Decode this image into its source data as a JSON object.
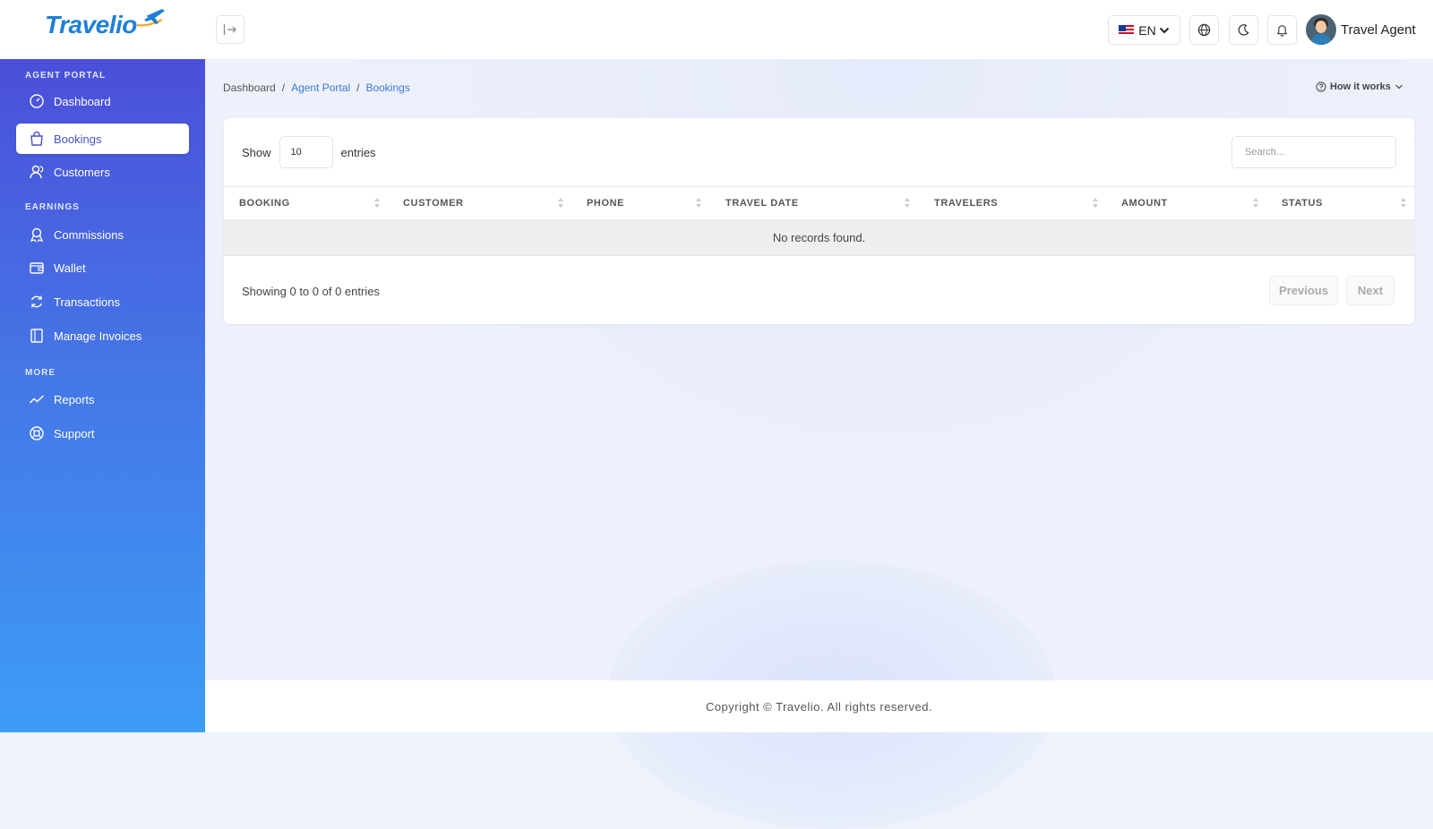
{
  "header": {
    "logo_text": "Travelio",
    "language": "EN",
    "user_name": "Travel Agent"
  },
  "sidebar": {
    "sections": [
      {
        "title": "AGENT PORTAL"
      },
      {
        "title": "EARNINGS"
      },
      {
        "title": "MORE"
      }
    ],
    "items": [
      {
        "label": "Dashboard",
        "icon": "speedometer-icon"
      },
      {
        "label": "Bookings",
        "icon": "shopping-bag-icon",
        "active": true
      },
      {
        "label": "Customers",
        "icon": "users-icon"
      },
      {
        "label": "Commissions",
        "icon": "award-icon"
      },
      {
        "label": "Wallet",
        "icon": "wallet-icon"
      },
      {
        "label": "Transactions",
        "icon": "refresh-icon"
      },
      {
        "label": "Manage Invoices",
        "icon": "receipt-icon"
      },
      {
        "label": "Reports",
        "icon": "trending-up-icon"
      },
      {
        "label": "Support",
        "icon": "lifebuoy-icon"
      }
    ]
  },
  "breadcrumb": [
    "Dashboard",
    "Agent Portal",
    "Bookings"
  ],
  "how_it_works": "How it works",
  "table": {
    "show_label": "Show",
    "page_size": "10",
    "entries_label": "entries",
    "search_placeholder": "Search...",
    "columns": [
      "BOOKING",
      "CUSTOMER",
      "PHONE",
      "TRAVEL DATE",
      "TRAVELERS",
      "AMOUNT",
      "STATUS"
    ],
    "empty_message": "No records found.",
    "info": "Showing 0 to 0 of 0 entries",
    "prev_label": "Previous",
    "next_label": "Next"
  },
  "footer": {
    "copyright": "Copyright © Travelio. All rights reserved."
  },
  "colors": {
    "sidebar_top": "#4b4fd9",
    "sidebar_bottom": "#3d9cf6",
    "accent": "#3a7bd5",
    "active_text": "#4a50c8"
  }
}
